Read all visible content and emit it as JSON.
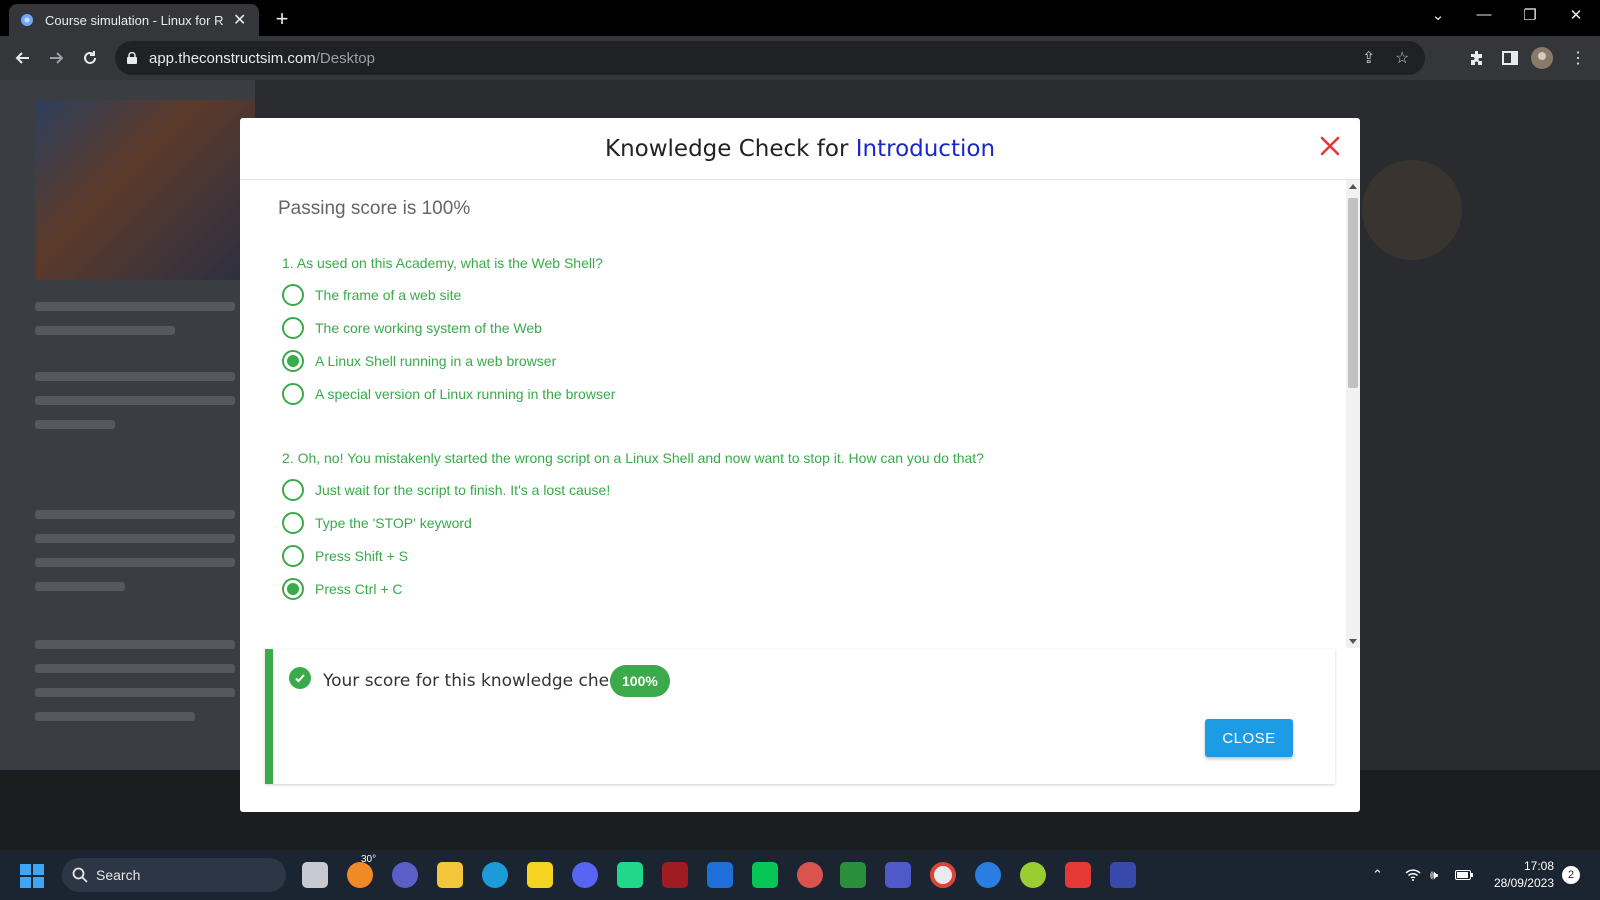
{
  "browser": {
    "tab_title": "Course simulation - Linux for Ro",
    "url_host": "app.theconstructsim.com",
    "url_path": "/Desktop"
  },
  "modal": {
    "title_prefix": "Knowledge Check for ",
    "title_accent": "Introduction",
    "passing_score": "Passing score is 100%",
    "questions": [
      {
        "text": "1. As used on this Academy, what is the Web Shell?",
        "options": [
          {
            "label": "The frame of a web site",
            "selected": false
          },
          {
            "label": "The core working system of the Web",
            "selected": false
          },
          {
            "label": "A Linux Shell running in a web browser",
            "selected": true
          },
          {
            "label": "A special version of Linux running in the browser",
            "selected": false
          }
        ]
      },
      {
        "text": "2. Oh, no! You mistakenly started the wrong script on a Linux Shell and now want to stop it. How can you do that?",
        "options": [
          {
            "label": "Just wait for the script to finish. It's a lost cause!",
            "selected": false
          },
          {
            "label": "Type the 'STOP' keyword",
            "selected": false
          },
          {
            "label": "Press Shift + S",
            "selected": false
          },
          {
            "label": "Press Ctrl + C",
            "selected": true
          }
        ]
      }
    ],
    "result": {
      "score_text": "Your score for this knowledge check:",
      "score_value": "100%",
      "close_label": "CLOSE"
    },
    "colors": {
      "accent_green": "#3aaa4a",
      "title_blue": "#1a28c8",
      "close_red": "#e53935",
      "button_blue": "#1e9be5"
    }
  },
  "taskbar": {
    "search_label": "Search",
    "weather_badge": "30°",
    "time": "17:08",
    "date": "28/09/2023",
    "notification_count": "2"
  }
}
